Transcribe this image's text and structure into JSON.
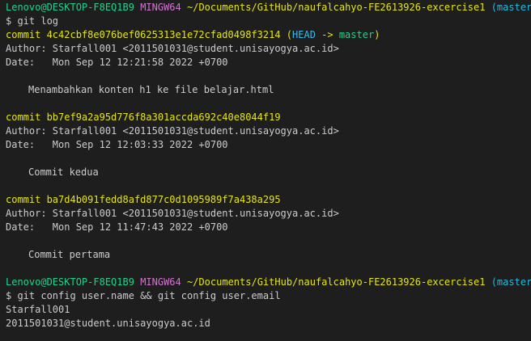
{
  "prompt1": {
    "user_host": "Lenovo@DESKTOP-F8EQ1B9",
    "shell": "MINGW64",
    "path": "~/Documents/GitHub/naufalcahyo-FE2613926-excercise1",
    "branch": "(master)",
    "command": "$ git log"
  },
  "commits": [
    {
      "commit_label": "commit 4c42cbf8e076bef0625313e1e72cfad0498f3214",
      "ref_open": " (",
      "head": "HEAD",
      "arrow": " -> ",
      "ref_branch": "master",
      "ref_close": ")",
      "author": "Author: Starfall001 <2011501031@student.unisayogya.ac.id>",
      "date": "Date:   Mon Sep 12 12:21:58 2022 +0700",
      "message": "Menambahkan konten h1 ke file belajar.html"
    },
    {
      "commit_label": "commit bb7ef9a2a95d776f8a301accda692c40e8044f19",
      "author": "Author: Starfall001 <2011501031@student.unisayogya.ac.id>",
      "date": "Date:   Mon Sep 12 12:03:33 2022 +0700",
      "message": "Commit kedua"
    },
    {
      "commit_label": "commit ba7d4b091fedd8afd877c0d1095989f7a438a295",
      "author": "Author: Starfall001 <2011501031@student.unisayogya.ac.id>",
      "date": "Date:   Mon Sep 12 11:47:43 2022 +0700",
      "message": "Commit pertama"
    }
  ],
  "prompt2": {
    "user_host": "Lenovo@DESKTOP-F8EQ1B9",
    "shell": "MINGW64",
    "path": "~/Documents/GitHub/naufalcahyo-FE2613926-excercise1",
    "branch": "(master)",
    "command": "$ git config user.name && git config user.email"
  },
  "output": {
    "user_name": "Starfall001",
    "user_email": "2011501031@student.unisayogya.ac.id"
  },
  "colors": {
    "background": "#1e1e1e",
    "text": "#cccccc",
    "user_host": "#23d18b",
    "shell": "#d670d6",
    "path": "#e5e510",
    "branch": "#29b8db",
    "commit": "#e5e510",
    "head": "#3bb9ec",
    "ref_branch": "#23d18b"
  }
}
